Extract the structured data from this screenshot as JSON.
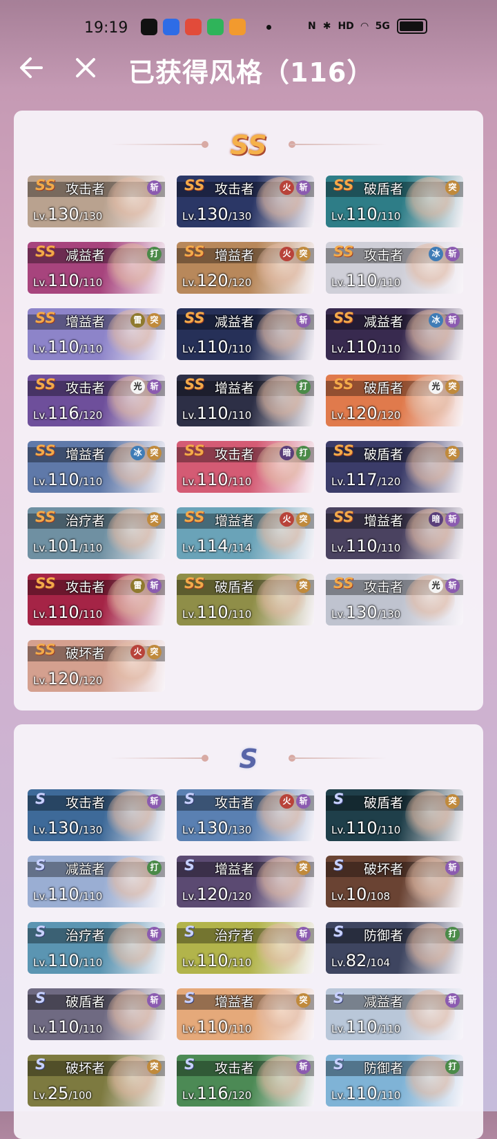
{
  "status_bar": {
    "time": "19:19",
    "network": "HD",
    "signal": "5G"
  },
  "header": {
    "title": "已获得风格（116）"
  },
  "sections": [
    {
      "rank": "SS",
      "cards": [
        {
          "rank": "SS",
          "role": "攻击者",
          "level": "130",
          "max": "130",
          "tags": [
            "斩"
          ],
          "bg": "#b9a28f"
        },
        {
          "rank": "SS",
          "role": "攻击者",
          "level": "130",
          "max": "130",
          "tags": [
            "火",
            "斩"
          ],
          "bg": "#2b3766"
        },
        {
          "rank": "SS",
          "role": "破盾者",
          "level": "110",
          "max": "110",
          "tags": [
            "突"
          ],
          "bg": "#2e7d87"
        },
        {
          "rank": "SS",
          "role": "减益者",
          "level": "110",
          "max": "110",
          "tags": [
            "打"
          ],
          "bg": "#a7447d"
        },
        {
          "rank": "SS",
          "role": "增益者",
          "level": "120",
          "max": "120",
          "tags": [
            "火",
            "突"
          ],
          "bg": "#b8885b"
        },
        {
          "rank": "SS",
          "role": "攻击者",
          "level": "110",
          "max": "110",
          "tags": [
            "冰",
            "斩"
          ],
          "bg": "#cfcfd8"
        },
        {
          "rank": "SS",
          "role": "增益者",
          "level": "110",
          "max": "110",
          "tags": [
            "雷",
            "突"
          ],
          "bg": "#8d84c9"
        },
        {
          "rank": "SS",
          "role": "减益者",
          "level": "110",
          "max": "110",
          "tags": [
            "斩"
          ],
          "bg": "#263058"
        },
        {
          "rank": "SS",
          "role": "减益者",
          "level": "110",
          "max": "110",
          "tags": [
            "冰",
            "斩"
          ],
          "bg": "#382a4f"
        },
        {
          "rank": "SS",
          "role": "攻击者",
          "level": "116",
          "max": "120",
          "tags": [
            "光",
            "斩"
          ],
          "bg": "#6e4f9b"
        },
        {
          "rank": "SS",
          "role": "增益者",
          "level": "110",
          "max": "110",
          "tags": [
            "打"
          ],
          "bg": "#2d2f46"
        },
        {
          "rank": "SS",
          "role": "破盾者",
          "level": "120",
          "max": "120",
          "tags": [
            "光",
            "突"
          ],
          "bg": "#e07a4c"
        },
        {
          "rank": "SS",
          "role": "增益者",
          "level": "110",
          "max": "110",
          "tags": [
            "冰",
            "突"
          ],
          "bg": "#5f79a9"
        },
        {
          "rank": "SS",
          "role": "攻击者",
          "level": "110",
          "max": "110",
          "tags": [
            "暗",
            "打"
          ],
          "bg": "#d45b74"
        },
        {
          "rank": "SS",
          "role": "破盾者",
          "level": "117",
          "max": "120",
          "tags": [
            "突"
          ],
          "bg": "#3b3c69"
        },
        {
          "rank": "SS",
          "role": "治疗者",
          "level": "101",
          "max": "110",
          "tags": [
            "突"
          ],
          "bg": "#6f90a2"
        },
        {
          "rank": "SS",
          "role": "增益者",
          "level": "114",
          "max": "114",
          "tags": [
            "火",
            "突"
          ],
          "bg": "#6aa3b8"
        },
        {
          "rank": "SS",
          "role": "增益者",
          "level": "110",
          "max": "110",
          "tags": [
            "暗",
            "斩"
          ],
          "bg": "#4a4260"
        },
        {
          "rank": "SS",
          "role": "攻击者",
          "level": "110",
          "max": "110",
          "tags": [
            "雷",
            "斩"
          ],
          "bg": "#a52446"
        },
        {
          "rank": "SS",
          "role": "破盾者",
          "level": "110",
          "max": "110",
          "tags": [
            "突"
          ],
          "bg": "#8f8e48"
        },
        {
          "rank": "SS",
          "role": "攻击者",
          "level": "130",
          "max": "130",
          "tags": [
            "光",
            "斩"
          ],
          "bg": "#bfc3cf"
        },
        {
          "rank": "SS",
          "role": "破坏者",
          "level": "120",
          "max": "120",
          "tags": [
            "火",
            "突"
          ],
          "bg": "#d4a08f"
        }
      ]
    },
    {
      "rank": "S",
      "cards": [
        {
          "rank": "S",
          "role": "攻击者",
          "level": "130",
          "max": "130",
          "tags": [
            "斩"
          ],
          "bg": "#3e6a99"
        },
        {
          "rank": "S",
          "role": "攻击者",
          "level": "130",
          "max": "130",
          "tags": [
            "火",
            "斩"
          ],
          "bg": "#5a80b2"
        },
        {
          "rank": "S",
          "role": "破盾者",
          "level": "110",
          "max": "110",
          "tags": [
            "突"
          ],
          "bg": "#1f3f4a"
        },
        {
          "rank": "S",
          "role": "减益者",
          "level": "110",
          "max": "110",
          "tags": [
            "打"
          ],
          "bg": "#9aaed3"
        },
        {
          "rank": "S",
          "role": "增益者",
          "level": "120",
          "max": "120",
          "tags": [
            "突"
          ],
          "bg": "#5b4a72"
        },
        {
          "rank": "S",
          "role": "破坏者",
          "level": "10",
          "max": "108",
          "tags": [
            "斩"
          ],
          "bg": "#6a4333"
        },
        {
          "rank": "S",
          "role": "治疗者",
          "level": "110",
          "max": "110",
          "tags": [
            "斩"
          ],
          "bg": "#5b95b2"
        },
        {
          "rank": "S",
          "role": "治疗者",
          "level": "110",
          "max": "110",
          "tags": [
            "斩"
          ],
          "bg": "#b2b44b"
        },
        {
          "rank": "S",
          "role": "防御者",
          "level": "82",
          "max": "104",
          "tags": [
            "打"
          ],
          "bg": "#3e4560"
        },
        {
          "rank": "S",
          "role": "破盾者",
          "level": "110",
          "max": "110",
          "tags": [
            "斩"
          ],
          "bg": "#6f6a82"
        },
        {
          "rank": "S",
          "role": "增益者",
          "level": "110",
          "max": "110",
          "tags": [
            "突"
          ],
          "bg": "#e5a97a"
        },
        {
          "rank": "S",
          "role": "减益者",
          "level": "110",
          "max": "110",
          "tags": [
            "斩"
          ],
          "bg": "#b9c7d9"
        },
        {
          "rank": "S",
          "role": "破坏者",
          "level": "25",
          "max": "100",
          "tags": [
            "突"
          ],
          "bg": "#7d7a40"
        },
        {
          "rank": "S",
          "role": "攻击者",
          "level": "116",
          "max": "120",
          "tags": [
            "斩"
          ],
          "bg": "#4c8a55"
        },
        {
          "rank": "S",
          "role": "防御者",
          "level": "110",
          "max": "110",
          "tags": [
            "打"
          ],
          "bg": "#7fb3d6"
        }
      ]
    }
  ],
  "tag_colors": {
    "斩": "#8b5bb0",
    "突": "#c08a3c",
    "打": "#4a8a48",
    "火": "#b8433a",
    "冰": "#3f7cb6",
    "雷": "#8f7a2e",
    "光": "#f5f5f5",
    "暗": "#5a3f7a"
  }
}
